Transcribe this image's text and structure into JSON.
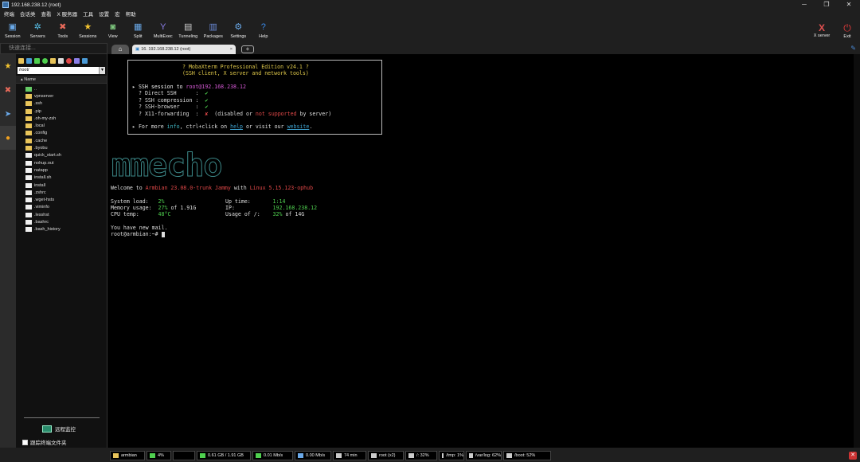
{
  "window": {
    "title": "192.168.238.12 (root)",
    "min": "─",
    "max": "❐",
    "close": "✕"
  },
  "menu": [
    "终端",
    "会话类",
    "查看",
    "X 服务器",
    "工具",
    "设置",
    "宏",
    "帮助"
  ],
  "toolbar": [
    {
      "label": "Session",
      "icon": "session-icon",
      "glyph": "▣",
      "color": "#6aa9e9"
    },
    {
      "label": "Servers",
      "icon": "servers-icon",
      "glyph": "✲",
      "color": "#58c0e8"
    },
    {
      "label": "Tools",
      "icon": "tools-icon",
      "glyph": "✖",
      "color": "#e86a5a"
    },
    {
      "label": "Sessions",
      "icon": "sessions-star-icon",
      "glyph": "★",
      "color": "#f4c430"
    },
    {
      "label": "View",
      "icon": "view-icon",
      "glyph": "◙",
      "color": "#7fc97f"
    },
    {
      "label": "Split",
      "icon": "split-icon",
      "glyph": "▦",
      "color": "#6aa9e9"
    },
    {
      "label": "MultiExec",
      "icon": "multiexec-icon",
      "glyph": "Y",
      "color": "#8b7fe8"
    },
    {
      "label": "Tunneling",
      "icon": "tunneling-icon",
      "glyph": "▤",
      "color": "#cccccc"
    },
    {
      "label": "Packages",
      "icon": "packages-icon",
      "glyph": "▥",
      "color": "#6a8ad6"
    },
    {
      "label": "Settings",
      "icon": "settings-icon",
      "glyph": "⚙",
      "color": "#6aa9e9"
    },
    {
      "label": "Help",
      "icon": "help-icon",
      "glyph": "?",
      "color": "#3a8ae8"
    }
  ],
  "toolbar_right": [
    {
      "label": "X server",
      "icon": "x-server-icon",
      "glyph": "X",
      "color": "#e05050"
    },
    {
      "label": "Exit",
      "icon": "exit-power-icon",
      "glyph": "⏻",
      "color": "#e03a3a"
    }
  ],
  "quick_connect": {
    "placeholder": "快速连接..."
  },
  "tabs": {
    "home_glyph": "⌂",
    "active_label": "16. 192.168.238.12 (root)",
    "close_glyph": "×",
    "add_glyph": "+",
    "pin_glyph": "✎"
  },
  "sidebar": {
    "path": "/root/",
    "column_header": "Name",
    "files": [
      {
        "name": "..",
        "type": "up"
      },
      {
        "name": "vpnserver",
        "type": "folder"
      },
      {
        "name": ".ssh",
        "type": "folder"
      },
      {
        "name": ".pip",
        "type": "folder"
      },
      {
        "name": ".oh-my-zsh",
        "type": "folder"
      },
      {
        "name": ".local",
        "type": "folder"
      },
      {
        "name": ".config",
        "type": "folder"
      },
      {
        "name": ".cache",
        "type": "folder"
      },
      {
        "name": ".byobu",
        "type": "folder"
      },
      {
        "name": "quick_start.sh",
        "type": "doc"
      },
      {
        "name": "nohup.out",
        "type": "doc"
      },
      {
        "name": "natapp",
        "type": "doc"
      },
      {
        "name": "install.sh",
        "type": "doc"
      },
      {
        "name": "install",
        "type": "doc"
      },
      {
        "name": ".zshrc",
        "type": "doc"
      },
      {
        "name": ".wget-hsts",
        "type": "doc"
      },
      {
        "name": ".viminfo",
        "type": "doc"
      },
      {
        "name": ".lesshst",
        "type": "doc"
      },
      {
        "name": ".bashrc",
        "type": "doc"
      },
      {
        "name": ".bash_history",
        "type": "doc"
      }
    ],
    "monitor_label": "远程监控",
    "follow_label": "跟踪终端文件夹"
  },
  "vertical_tabs": [
    {
      "icon": "sessions-star-icon",
      "glyph": "★",
      "color": "#f4c430"
    },
    {
      "icon": "tools-icon",
      "glyph": "✖",
      "color": "#e86a5a"
    },
    {
      "icon": "macros-icon",
      "glyph": "➤",
      "color": "#6aa9e9"
    },
    {
      "icon": "sftp-icon",
      "glyph": "●",
      "color": "#f0a020"
    }
  ],
  "terminal": {
    "banner_title": "? MobaXterm Professional Edition v24.1 ?",
    "banner_subtitle": "(SSH client, X server and network tools)",
    "ssh_session_prefix": "▸ SSH session to ",
    "ssh_session_target": "root@192.168.238.12",
    "direct_ssh_label": "? Direct SSH      :  ",
    "ssh_compression_label": "? SSH compression :  ",
    "ssh_browser_label": "? SSH-browser     :  ",
    "x11_label": "? X11-forwarding  :  ",
    "check": "✔",
    "cross": "✘",
    "x11_note_1": "  (disabled or ",
    "x11_note_2": "not supported",
    "x11_note_3": " by server)",
    "more_1": "▸ For more ",
    "more_info": "info",
    "more_2": ", ctrl+click on ",
    "more_help": "help",
    "more_3": " or visit our ",
    "more_website": "website",
    "more_4": ".",
    "logo_text": "mmecho",
    "welcome_1": "Welcome to ",
    "welcome_distro": "Armbian 23.08.0-trunk Jammy",
    "welcome_2": " with ",
    "welcome_kernel": "Linux 5.15.123-ophub",
    "sys_load_label": "System load:   ",
    "sys_load": "2%",
    "mem_label": "Memory usage:  ",
    "mem_pct": "27%",
    "mem_of": " of 1.91G",
    "cpu_label": "CPU temp:      ",
    "cpu_temp": "48°C",
    "uptime_label": "Up time:       ",
    "uptime": "1:14",
    "ip_label": "IP:            ",
    "ip": "192.168.238.12",
    "usage_label": "Usage of /:    ",
    "usage_pct": "32%",
    "usage_of": " of 14G",
    "mail": "You have new mail.",
    "prompt": "root@armbian:~# "
  },
  "statusbar": [
    {
      "text": "armbian",
      "icon": "linux-icon",
      "color": "#e8c45a"
    },
    {
      "text": "4%",
      "icon": "cpu-icon",
      "color": "#4fd04f"
    },
    {
      "text": "",
      "icon": "cpu-graph",
      "color": "#000000"
    },
    {
      "text": "0.61 GB / 1.91 GB",
      "icon": "memory-icon",
      "color": "#4fd04f"
    },
    {
      "text": "0.01 Mb/s",
      "icon": "upload-icon",
      "color": "#4fd04f"
    },
    {
      "text": "0.00 Mb/s",
      "icon": "download-icon",
      "color": "#6aa9e9"
    },
    {
      "text": "74 min",
      "icon": "uptime-icon",
      "color": "#cccccc"
    },
    {
      "text": "root (x2)",
      "icon": "users-icon",
      "color": "#cccccc"
    },
    {
      "text": "/: 32%",
      "icon": "disk-icon",
      "color": "#cccccc"
    },
    {
      "text": "/tmp: 1%",
      "icon": "disk-icon",
      "color": "#cccccc"
    },
    {
      "text": "/var/log: 62%",
      "icon": "disk-icon",
      "color": "#cccccc"
    },
    {
      "text": "/boot: 52%",
      "icon": "disk-icon",
      "color": "#cccccc"
    }
  ],
  "status_close": "✕"
}
